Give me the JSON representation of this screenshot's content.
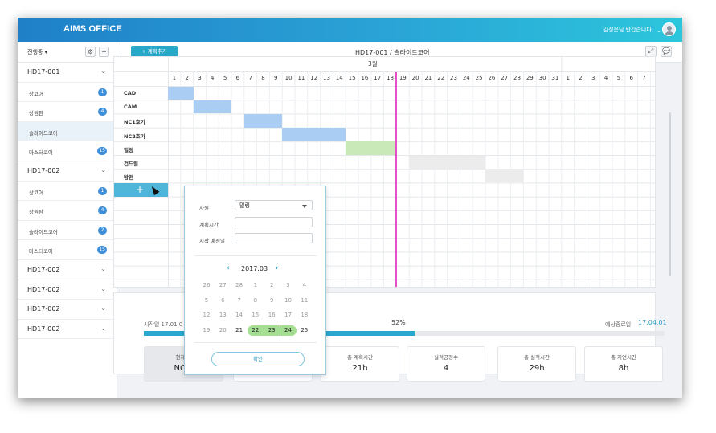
{
  "header": {
    "app_title": "AIMS OFFICE",
    "greeting": "김성운님 반갑습니다.",
    "caret": "⌄"
  },
  "sidebar": {
    "filter_label": "진행중 ▾",
    "settings_icon": "⚙",
    "add_icon": "+",
    "items": [
      {
        "type": "group",
        "label": "HD17-001",
        "chev": "⌄"
      },
      {
        "type": "sub",
        "label": "상코어",
        "badge": "1"
      },
      {
        "type": "sub",
        "label": "상원판",
        "badge": "4"
      },
      {
        "type": "sub",
        "label": "슬라이드코어",
        "badge": "",
        "selected": true
      },
      {
        "type": "sub",
        "label": "마스터코어",
        "badge": "15"
      },
      {
        "type": "group",
        "label": "HD17-002",
        "chev": "⌄"
      },
      {
        "type": "sub",
        "label": "상코어",
        "badge": "1"
      },
      {
        "type": "sub",
        "label": "상원판",
        "badge": "4"
      },
      {
        "type": "sub",
        "label": "슬라이드코어",
        "badge": "2"
      },
      {
        "type": "sub",
        "label": "마스터코어",
        "badge": "15"
      },
      {
        "type": "group",
        "label": "HD17-002",
        "chev": "⌄"
      },
      {
        "type": "group",
        "label": "HD17-002",
        "chev": "⌄"
      },
      {
        "type": "group",
        "label": "HD17-002",
        "chev": "⌄"
      },
      {
        "type": "group",
        "label": "HD17-002",
        "chev": "⌄"
      }
    ]
  },
  "toolbar": {
    "add_plan_label": "+ 계획추가",
    "breadcrumb": "HD17-001 /  슬라이드코어",
    "expand_icon": "⤢",
    "comment_icon": "💬"
  },
  "gantt": {
    "month": "3월",
    "days": [
      "1",
      "2",
      "3",
      "4",
      "5",
      "6",
      "7",
      "8",
      "9",
      "10",
      "11",
      "12",
      "13",
      "14",
      "15",
      "16",
      "17",
      "18",
      "19",
      "20",
      "21",
      "22",
      "23",
      "24",
      "25",
      "26",
      "27",
      "28",
      "29",
      "30",
      "31",
      "1",
      "2",
      "3",
      "4",
      "5",
      "6",
      "7"
    ],
    "tasks": [
      {
        "label": "CAD",
        "start": 1,
        "end": 2,
        "color": "#a9cdf3"
      },
      {
        "label": "CAM",
        "start": 3,
        "end": 5,
        "color": "#a9cdf3"
      },
      {
        "label": "NC1호기",
        "start": 7,
        "end": 9,
        "color": "#a9cdf3"
      },
      {
        "label": "NC2호기",
        "start": 10,
        "end": 14,
        "color": "#a9cdf3"
      },
      {
        "label": "밀링",
        "start": 15,
        "end": 18,
        "color": "#c9eab8"
      },
      {
        "label": "건드릴",
        "start": 20,
        "end": 25,
        "color": "#ececec"
      },
      {
        "label": "방전",
        "start": 26,
        "end": 28,
        "color": "#ececec"
      }
    ],
    "today_day": 18,
    "add_row_plus": "+"
  },
  "popup": {
    "resource_label": "자원",
    "resource_value": "밀링",
    "plan_time_label": "계획시간",
    "plan_time_value": "",
    "start_date_label": "시작 예정일",
    "start_date_value": "",
    "calendar_title": "2017.03",
    "prev_arrow": "‹",
    "next_arrow": "›",
    "calendar_rows": [
      [
        "26",
        "27",
        "28",
        "1",
        "2",
        "3",
        "4"
      ],
      [
        "5",
        "6",
        "7",
        "8",
        "9",
        "10",
        "11"
      ],
      [
        "12",
        "13",
        "14",
        "15",
        "16",
        "17",
        "18"
      ],
      [
        "19",
        "20",
        "21",
        "22",
        "23",
        "24",
        "25"
      ]
    ],
    "selected_days": [
      "22",
      "23",
      "24"
    ],
    "confirm_label": "확인"
  },
  "summary": {
    "start_label": "시작일 17.01.0",
    "progress_percent": 52,
    "progress_text": "52%",
    "end_label": "예상종료일",
    "end_value": "17.04.01",
    "stats": [
      {
        "label": "현재 진",
        "value": "NC 3",
        "highlight": true
      },
      {
        "label": "",
        "value": "",
        "highlight": false
      },
      {
        "label": "총 계획시간",
        "value": "21h",
        "highlight": false
      },
      {
        "label": "실적공정수",
        "value": "4",
        "highlight": false
      },
      {
        "label": "총 실적시간",
        "value": "29h",
        "highlight": false
      },
      {
        "label": "총 지연시간",
        "value": "8h",
        "highlight": false
      }
    ]
  },
  "colors": {
    "accent": "#27a8c9",
    "badge": "#3e8fd8",
    "today_line": "#e84ec9",
    "header_start": "#1f80c8",
    "header_end": "#2cc6dc"
  }
}
